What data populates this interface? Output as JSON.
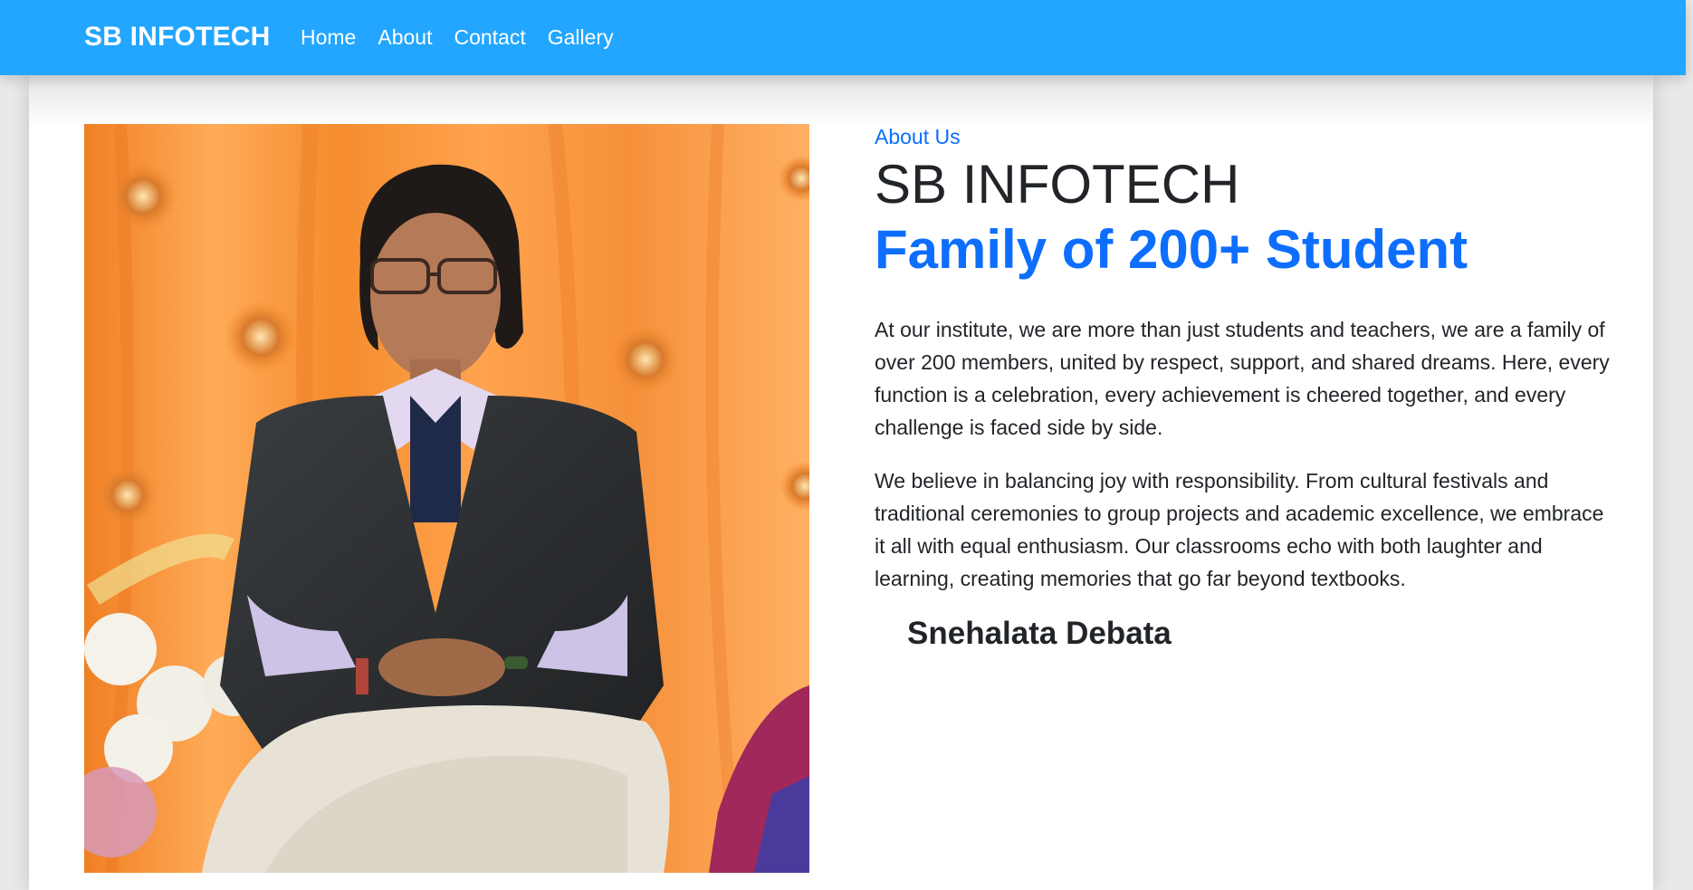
{
  "navbar": {
    "brand": "SB INFOTECH",
    "links": [
      {
        "label": "Home"
      },
      {
        "label": "About"
      },
      {
        "label": "Contact"
      },
      {
        "label": "Gallery"
      }
    ],
    "background_color": "#23a6ff"
  },
  "about": {
    "eyebrow": "About Us",
    "title": "SB INFOTECH",
    "subtitle": "Family of 200+ Student",
    "paragraphs": [
      "At our institute, we are more than just students and teachers, we are a family of over 200 members, united by respect, support, and shared dreams. Here, every function is a celebration, every achievement is cheered together, and every challenge is faced side by side.",
      "We believe in balancing joy with responsibility. From cultural festivals and traditional ceremonies to group projects and academic excellence, we embrace it all with equal enthusiasm. Our classrooms echo with both laughter and learning, creating memories that go far beyond textbooks."
    ],
    "signature": "Snehalata Debata",
    "accent_color": "#0d6efd"
  },
  "photo": {
    "description_icon": "person-portrait-photo"
  }
}
